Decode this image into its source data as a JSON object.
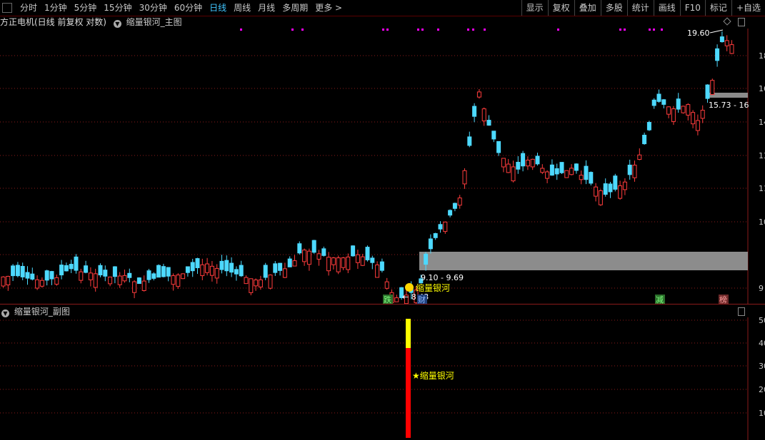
{
  "toolbar": {
    "periods": [
      {
        "label": "分时",
        "active": false
      },
      {
        "label": "1分钟",
        "active": false
      },
      {
        "label": "5分钟",
        "active": false
      },
      {
        "label": "15分钟",
        "active": false
      },
      {
        "label": "30分钟",
        "active": false
      },
      {
        "label": "60分钟",
        "active": false
      },
      {
        "label": "日线",
        "active": true
      },
      {
        "label": "周线",
        "active": false
      },
      {
        "label": "月线",
        "active": false
      },
      {
        "label": "多周期",
        "active": false
      },
      {
        "label": "更多",
        "active": false
      }
    ],
    "right_items": [
      "显示",
      "复权",
      "叠加",
      "多股",
      "统计",
      "画线",
      "F10",
      "标记",
      "+自选"
    ]
  },
  "main_chart": {
    "stock_title": "方正电机(日线 前复权 对数)",
    "indicator_title": "缩量银河_主图",
    "high_label": "19.60",
    "low_label": "8.43",
    "zone_low_label": "9.10 - 9.69",
    "zone_high_label": "15.73 - 16",
    "signal_label": "缩量银河",
    "y_axis_labels": [
      "18",
      "16",
      "14",
      "13",
      "11",
      "10",
      "9"
    ],
    "event_tags": [
      "跌",
      "财",
      "减",
      "榜"
    ],
    "colors": {
      "up": "#ff3c3c",
      "down": "#4dd9ff",
      "zone": "#8c8c8c",
      "marker": "#ff00ff",
      "grid": "#8b1a1a"
    }
  },
  "sub_chart": {
    "indicator_title": "缩量银河_副图",
    "signal_label": "★缩量银河",
    "y_axis_labels": [
      "50",
      "40",
      "30",
      "20",
      "10"
    ],
    "colors": {
      "bar_top": "#ffff00",
      "bar_bottom": "#ff0000"
    }
  }
}
